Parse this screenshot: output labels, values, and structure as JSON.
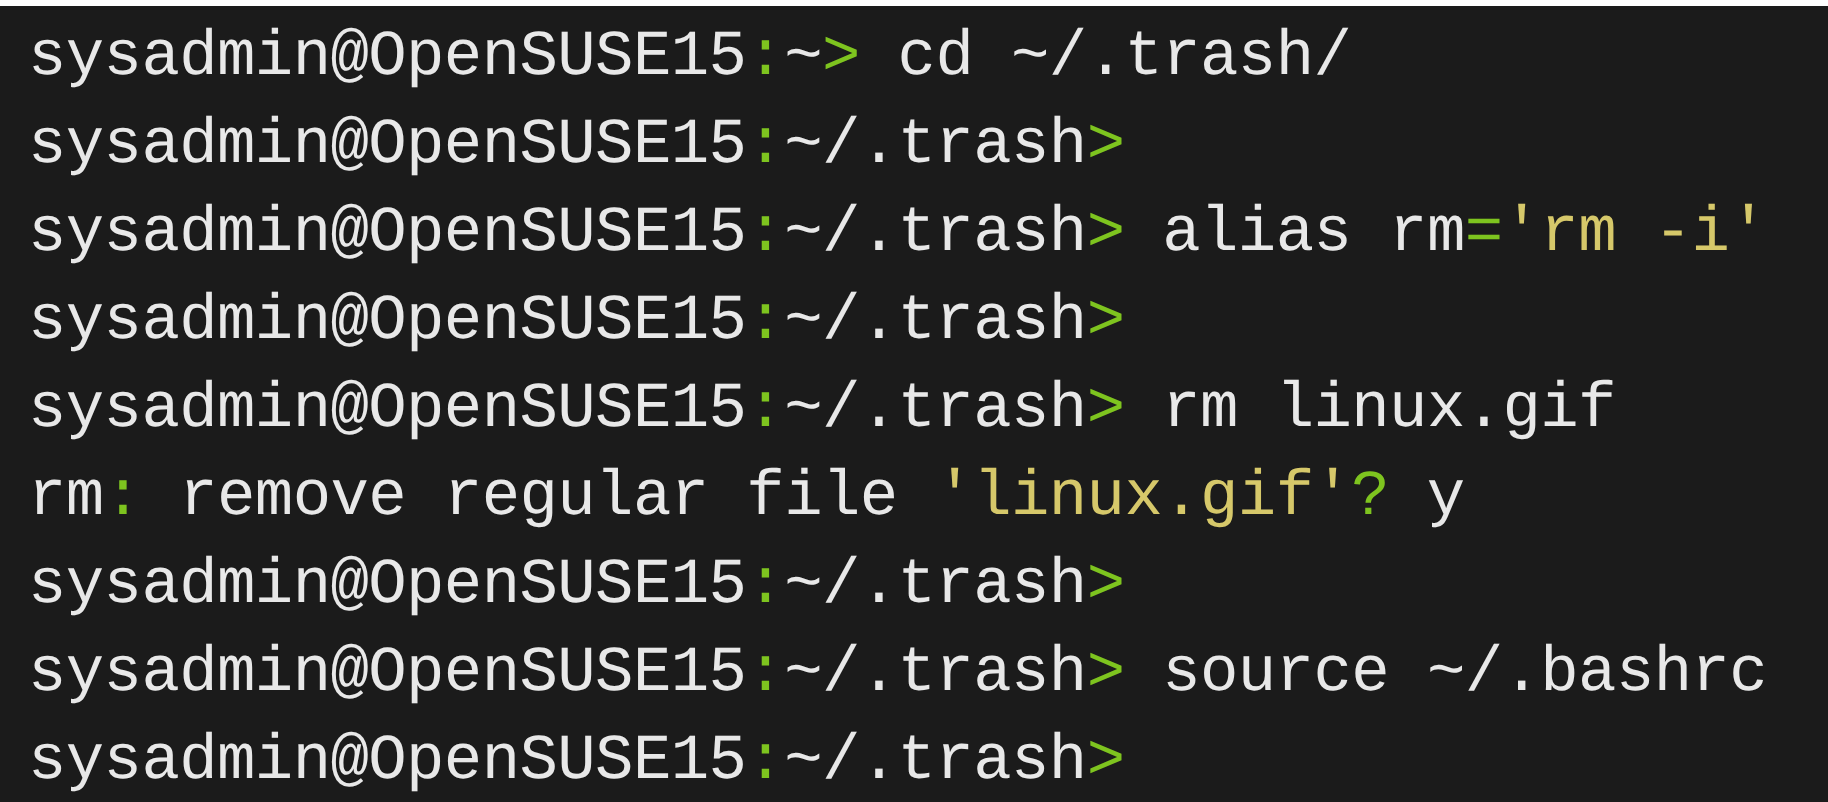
{
  "terminal": {
    "lines": [
      [
        {
          "kind": "plain",
          "text": "sysadmin@OpenSUSE15"
        },
        {
          "kind": "accent",
          "text": ":"
        },
        {
          "kind": "plain",
          "text": "~"
        },
        {
          "kind": "accent",
          "text": ">"
        },
        {
          "kind": "plain",
          "text": " cd ~/.trash/"
        }
      ],
      [
        {
          "kind": "plain",
          "text": "sysadmin@OpenSUSE15"
        },
        {
          "kind": "accent",
          "text": ":"
        },
        {
          "kind": "plain",
          "text": "~/.trash"
        },
        {
          "kind": "accent",
          "text": ">"
        }
      ],
      [
        {
          "kind": "plain",
          "text": "sysadmin@OpenSUSE15"
        },
        {
          "kind": "accent",
          "text": ":"
        },
        {
          "kind": "plain",
          "text": "~/.trash"
        },
        {
          "kind": "accent",
          "text": ">"
        },
        {
          "kind": "plain",
          "text": " alias rm"
        },
        {
          "kind": "accent",
          "text": "="
        },
        {
          "kind": "string",
          "text": "'rm -i'"
        }
      ],
      [
        {
          "kind": "plain",
          "text": "sysadmin@OpenSUSE15"
        },
        {
          "kind": "accent",
          "text": ":"
        },
        {
          "kind": "plain",
          "text": "~/.trash"
        },
        {
          "kind": "accent",
          "text": ">"
        }
      ],
      [
        {
          "kind": "plain",
          "text": "sysadmin@OpenSUSE15"
        },
        {
          "kind": "accent",
          "text": ":"
        },
        {
          "kind": "plain",
          "text": "~/.trash"
        },
        {
          "kind": "accent",
          "text": ">"
        },
        {
          "kind": "plain",
          "text": " rm linux.gif"
        }
      ],
      [
        {
          "kind": "plain",
          "text": "rm"
        },
        {
          "kind": "accent",
          "text": ":"
        },
        {
          "kind": "plain",
          "text": " remove regular file "
        },
        {
          "kind": "string",
          "text": "'linux.gif'"
        },
        {
          "kind": "accent",
          "text": "?"
        },
        {
          "kind": "plain",
          "text": " y"
        }
      ],
      [
        {
          "kind": "plain",
          "text": "sysadmin@OpenSUSE15"
        },
        {
          "kind": "accent",
          "text": ":"
        },
        {
          "kind": "plain",
          "text": "~/.trash"
        },
        {
          "kind": "accent",
          "text": ">"
        }
      ],
      [
        {
          "kind": "plain",
          "text": "sysadmin@OpenSUSE15"
        },
        {
          "kind": "accent",
          "text": ":"
        },
        {
          "kind": "plain",
          "text": "~/.trash"
        },
        {
          "kind": "accent",
          "text": ">"
        },
        {
          "kind": "plain",
          "text": " source ~/.bashrc"
        }
      ],
      [
        {
          "kind": "plain",
          "text": "sysadmin@OpenSUSE15"
        },
        {
          "kind": "accent",
          "text": ":"
        },
        {
          "kind": "plain",
          "text": "~/.trash"
        },
        {
          "kind": "accent",
          "text": ">"
        }
      ]
    ]
  }
}
